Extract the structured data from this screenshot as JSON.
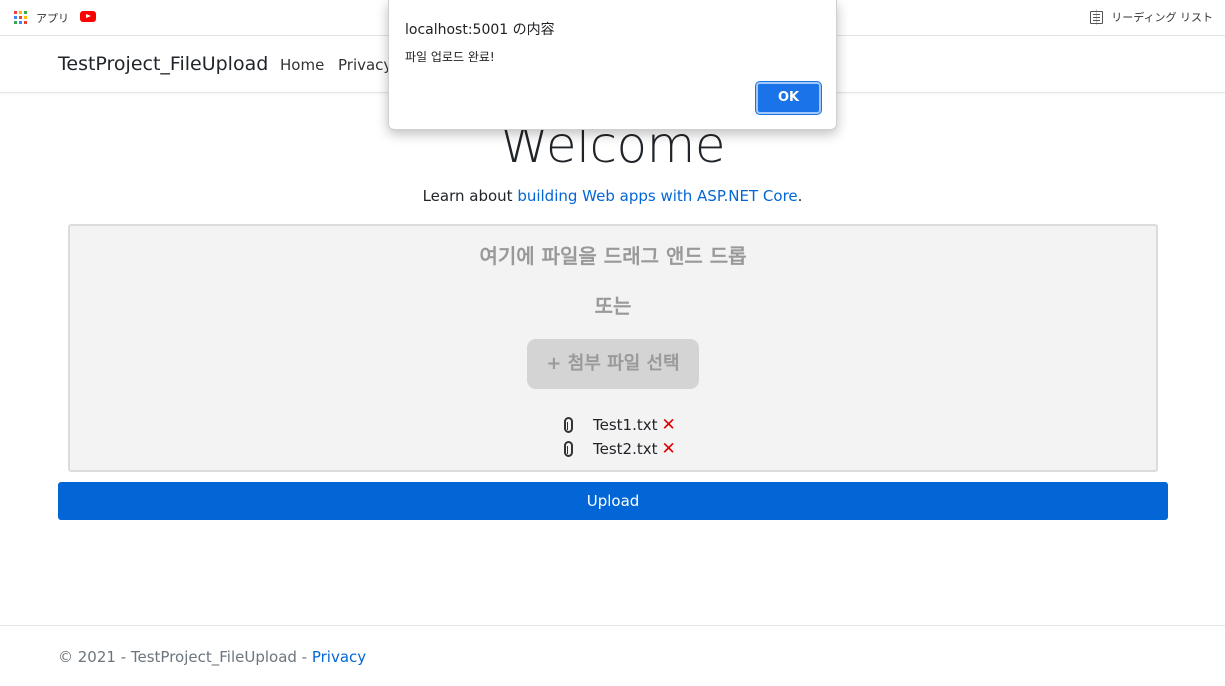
{
  "bookmarks": {
    "apps_label": "アプリ",
    "reading_list_label": "リーディング リスト"
  },
  "navbar": {
    "brand": "TestProject_FileUpload",
    "links": [
      "Home",
      "Privacy"
    ]
  },
  "main": {
    "heading": "Welcome",
    "learn_prefix": "Learn about ",
    "learn_link": "building Web apps with ASP.NET Core",
    "learn_suffix": ".",
    "dropzone": {
      "title": "여기에 파일을 드래그 앤드 드롭",
      "or": "또는",
      "button": "+ 첨부 파일 선택",
      "files": [
        "Test1.txt",
        "Test2.txt"
      ],
      "remove_glyph": "✕"
    },
    "upload_button": "Upload"
  },
  "footer": {
    "copyright": "© 2021 - TestProject_FileUpload - ",
    "privacy": "Privacy"
  },
  "dialog": {
    "title": "localhost:5001 の内容",
    "message": "파일 업로드 완료!",
    "ok": "OK"
  },
  "colors": {
    "link": "#0366d6",
    "primary_button": "#0366d6",
    "dialog_button": "#1a73e8",
    "remove": "#e00000",
    "dropzone_bg": "#f3f3f3"
  },
  "icons": [
    "apps-grid-icon",
    "youtube-icon",
    "reading-list-icon",
    "paperclip-icon",
    "remove-icon"
  ]
}
